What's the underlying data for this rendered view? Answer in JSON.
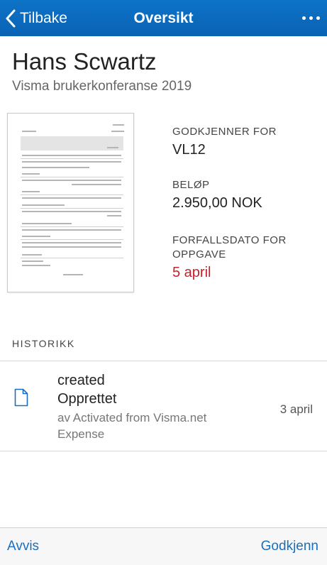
{
  "nav": {
    "back_label": "Tilbake",
    "title": "Oversikt",
    "more_icon": "more-horizontal-icon"
  },
  "header": {
    "name": "Hans Scwartz",
    "subtitle": "Visma brukerkonferanse 2019"
  },
  "details": {
    "approver_label": "GODKJENNER FOR",
    "approver_value": "VL12",
    "amount_label": "BELØP",
    "amount_value": "2.950,00 NOK",
    "due_label": "FORFALLSDATO FOR OPPGAVE",
    "due_value": "5 april"
  },
  "history": {
    "header": "HISTORIKK",
    "items": [
      {
        "icon": "document-icon",
        "action": "created",
        "status": "Opprettet",
        "by": "av Activated from Visma.net Expense",
        "date": "3 april"
      }
    ]
  },
  "actions": {
    "reject_label": "Avvis",
    "approve_label": "Godkjenn"
  },
  "colors": {
    "nav_bg": "#0a62b4",
    "accent": "#1a6fbd",
    "due_date": "#c8202b"
  }
}
